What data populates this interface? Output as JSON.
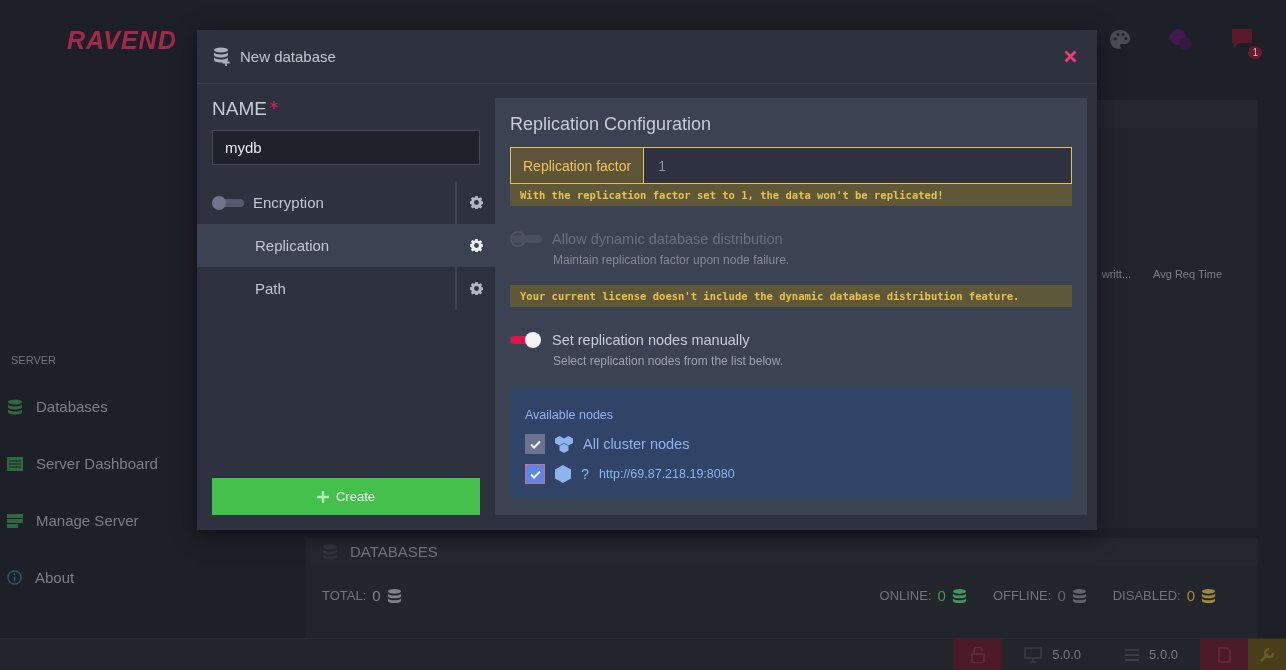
{
  "app": {
    "logo": "RAVEND",
    "notification_count": "1"
  },
  "sidebar": {
    "heading": "SERVER",
    "items": [
      {
        "label": "Databases"
      },
      {
        "label": "Server Dashboard"
      },
      {
        "label": "Manage Server"
      },
      {
        "label": "About"
      }
    ]
  },
  "traffic_table": {
    "columns": [
      "writt...",
      "Avg Req Time"
    ]
  },
  "databases_panel": {
    "title": "DATABASES",
    "counts": [
      {
        "kind": "total",
        "label": "TOTAL:",
        "value": "0"
      },
      {
        "kind": "online",
        "label": "ONLINE:",
        "value": "0"
      },
      {
        "kind": "offline",
        "label": "OFFLINE:",
        "value": "0"
      },
      {
        "kind": "disabled",
        "label": "DISABLED:",
        "value": "0"
      }
    ]
  },
  "status_bar": {
    "studio_version": "5.0.0",
    "server_version": "5.0.0"
  },
  "modal": {
    "title": "New database",
    "name_label": "NAME",
    "name_value": "mydb",
    "sections": [
      {
        "kind": "toggle",
        "label": "Encryption",
        "on": false,
        "selected": false
      },
      {
        "kind": "plain",
        "label": "Replication",
        "selected": true
      },
      {
        "kind": "plain",
        "label": "Path",
        "selected": false
      }
    ],
    "create_button": "Create",
    "replication": {
      "title": "Replication Configuration",
      "factor_label": "Replication factor",
      "factor_value": "1",
      "factor_warning": "With the replication factor set to 1, the data won't be replicated!",
      "options": [
        {
          "kind": "toggle",
          "label": "Allow dynamic database distribution",
          "hint": "Maintain replication factor upon node failure.",
          "on": false,
          "disabled": true
        },
        {
          "kind": "warning",
          "text": "Your current license doesn't include the dynamic database distribution feature."
        },
        {
          "kind": "toggle",
          "label": "Set replication nodes manually",
          "hint": "Select replication nodes from the list below.",
          "on": true,
          "disabled": false
        }
      ],
      "nodes": {
        "title": "Available nodes",
        "items": [
          {
            "kind": "all",
            "label": "All cluster nodes",
            "checked": true
          },
          {
            "kind": "node",
            "tag": "?",
            "url": "http://69.87.218.19:8080",
            "checked": true
          }
        ]
      }
    }
  }
}
